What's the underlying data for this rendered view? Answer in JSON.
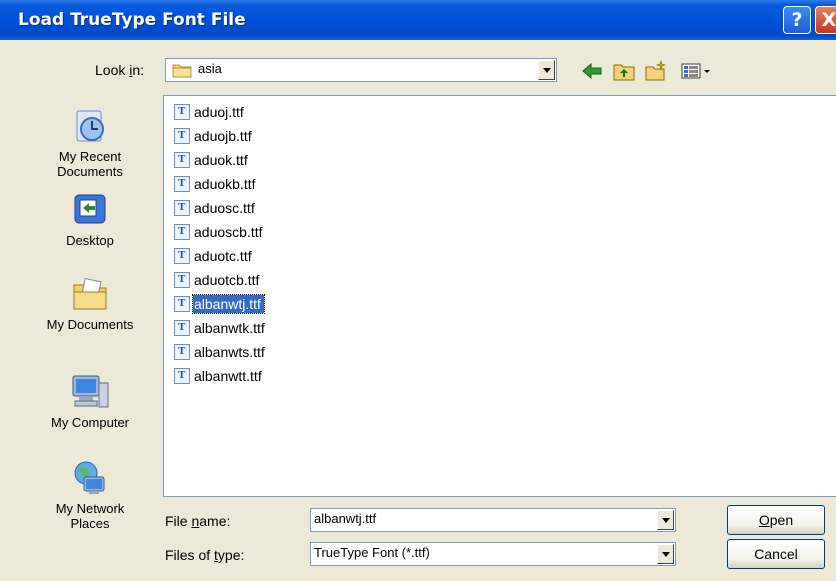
{
  "dialog": {
    "title": "Load TrueType Font File",
    "help_label": "?",
    "close_label": "X"
  },
  "look_in": {
    "label_pre": "Look ",
    "label_mnemonic": "i",
    "label_post": "n:",
    "value": "asia"
  },
  "toolbar": {
    "icons": [
      "back-arrow-icon",
      "up-one-level-icon",
      "create-new-folder-icon",
      "view-menu-icon"
    ]
  },
  "places": [
    {
      "label_line1": "My Recent",
      "label_line2": "Documents",
      "icon": "recent-documents-icon"
    },
    {
      "label_line1": "Desktop",
      "label_line2": "",
      "icon": "desktop-icon"
    },
    {
      "label_line1": "My Documents",
      "label_line2": "",
      "icon": "my-documents-icon"
    },
    {
      "label_line1": "My Computer",
      "label_line2": "",
      "icon": "my-computer-icon"
    },
    {
      "label_line1": "My Network",
      "label_line2": "Places",
      "icon": "network-places-icon"
    }
  ],
  "files": [
    {
      "name": "aduoj.ttf",
      "selected": false
    },
    {
      "name": "aduojb.ttf",
      "selected": false
    },
    {
      "name": "aduok.ttf",
      "selected": false
    },
    {
      "name": "aduokb.ttf",
      "selected": false
    },
    {
      "name": "aduosc.ttf",
      "selected": false
    },
    {
      "name": "aduoscb.ttf",
      "selected": false
    },
    {
      "name": "aduotc.ttf",
      "selected": false
    },
    {
      "name": "aduotcb.ttf",
      "selected": false
    },
    {
      "name": "albanwtj.ttf",
      "selected": true
    },
    {
      "name": "albanwtk.ttf",
      "selected": false
    },
    {
      "name": "albanwts.ttf",
      "selected": false
    },
    {
      "name": "albanwtt.ttf",
      "selected": false
    }
  ],
  "file_name": {
    "label_pre": "File ",
    "label_mnemonic": "n",
    "label_post": "ame:",
    "value": "albanwtj.ttf"
  },
  "file_type": {
    "label_pre": "Files of ",
    "label_mnemonic": "t",
    "label_post": "ype:",
    "value": "TrueType Font (*.ttf)"
  },
  "buttons": {
    "open_mnemonic": "O",
    "open_rest": "pen",
    "cancel": "Cancel"
  },
  "colors": {
    "titlebar": "#0050D8",
    "dialog_bg": "#ECE9D8",
    "selection": "#316AC5"
  }
}
